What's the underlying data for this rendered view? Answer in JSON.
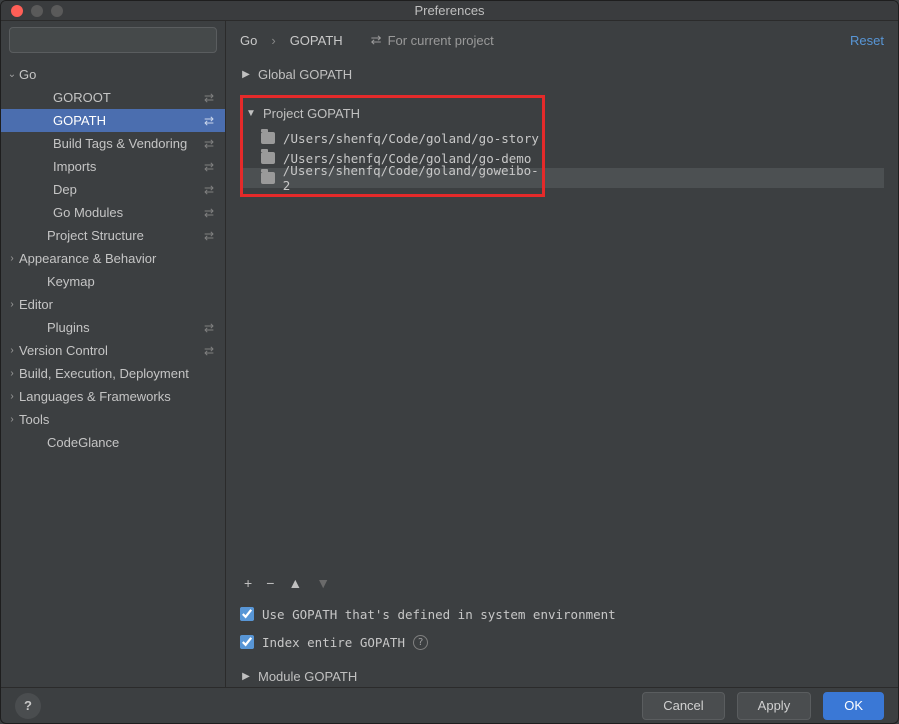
{
  "window": {
    "title": "Preferences"
  },
  "search": {
    "placeholder": ""
  },
  "sidebar": {
    "items": [
      {
        "label": "Go",
        "depth": 0,
        "expandable": true,
        "expanded": true,
        "badge": ""
      },
      {
        "label": "GOROOT",
        "depth": 2,
        "badge": "⇄"
      },
      {
        "label": "GOPATH",
        "depth": 2,
        "badge": "⇄",
        "selected": true
      },
      {
        "label": "Build Tags & Vendoring",
        "depth": 2,
        "badge": "⇄"
      },
      {
        "label": "Imports",
        "depth": 2,
        "badge": "⇄"
      },
      {
        "label": "Dep",
        "depth": 2,
        "badge": "⇄"
      },
      {
        "label": "Go Modules",
        "depth": 2,
        "badge": "⇄"
      },
      {
        "label": "Project Structure",
        "depth": 1,
        "badge": "⇄"
      },
      {
        "label": "Appearance & Behavior",
        "depth": 0,
        "expandable": true,
        "expanded": false
      },
      {
        "label": "Keymap",
        "depth": 1
      },
      {
        "label": "Editor",
        "depth": 0,
        "expandable": true,
        "expanded": false
      },
      {
        "label": "Plugins",
        "depth": 1,
        "badge": "⇄"
      },
      {
        "label": "Version Control",
        "depth": 0,
        "expandable": true,
        "expanded": false,
        "badge": "⇄"
      },
      {
        "label": "Build, Execution, Deployment",
        "depth": 0,
        "expandable": true,
        "expanded": false
      },
      {
        "label": "Languages & Frameworks",
        "depth": 0,
        "expandable": true,
        "expanded": false
      },
      {
        "label": "Tools",
        "depth": 0,
        "expandable": true,
        "expanded": false
      },
      {
        "label": "CodeGlance",
        "depth": 1
      }
    ]
  },
  "breadcrumb": {
    "parts": [
      "Go",
      "GOPATH"
    ]
  },
  "for_project_label": "For current project",
  "reset_label": "Reset",
  "sections": {
    "global": {
      "label": "Global GOPATH",
      "expanded": false
    },
    "project": {
      "label": "Project GOPATH",
      "expanded": true,
      "paths": [
        "/Users/shenfq/Code/goland/go-story",
        "/Users/shenfq/Code/goland/go-demo",
        "/Users/shenfq/Code/goland/goweibo-2"
      ],
      "selected_index": 2
    },
    "module": {
      "label": "Module GOPATH",
      "expanded": false
    }
  },
  "toolbar": {
    "add": "+",
    "remove": "−",
    "up": "▲",
    "down": "▼"
  },
  "checks": {
    "use_system": {
      "label": "Use GOPATH that's defined in system environment",
      "checked": true
    },
    "index_all": {
      "label": "Index entire GOPATH",
      "checked": true
    }
  },
  "footer": {
    "cancel": "Cancel",
    "apply": "Apply",
    "ok": "OK"
  }
}
